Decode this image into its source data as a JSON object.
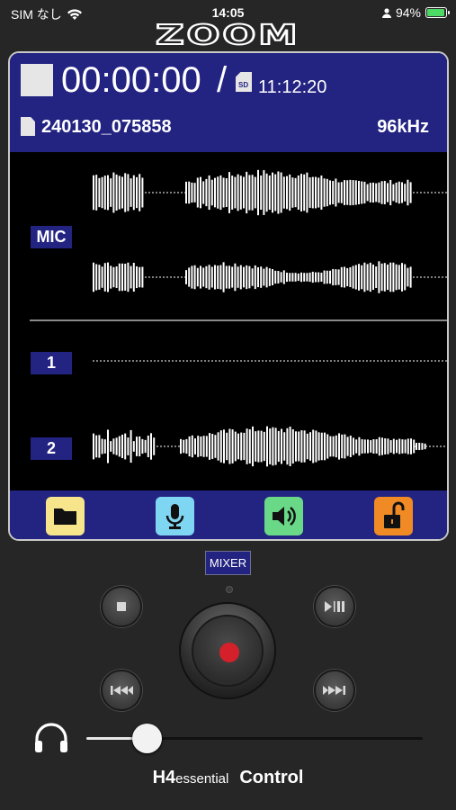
{
  "status_bar": {
    "carrier": "SIM なし",
    "time": "14:05",
    "battery_percent": "94%",
    "battery_level": 0.94
  },
  "logo": "ZOOM",
  "recorder": {
    "elapsed_time": "00:00:00",
    "separator": "/",
    "sd_label": "SD",
    "remaining_time": "11:12:20",
    "file_name": "240130_075858",
    "sample_rate": "96kHz"
  },
  "tracks": {
    "mic_label": "MIC",
    "track1_label": "1",
    "track2_label": "2"
  },
  "function_buttons": [
    {
      "name": "folder",
      "icon": "folder-icon",
      "color": "#f6e58a"
    },
    {
      "name": "mic",
      "icon": "microphone-icon",
      "color": "#7fd6f2"
    },
    {
      "name": "speaker",
      "icon": "speaker-icon",
      "color": "#6ad987"
    },
    {
      "name": "lock",
      "icon": "unlock-icon",
      "color": "#f08a24"
    }
  ],
  "controls": {
    "mixer_label": "MIXER",
    "volume_level": 0.18
  },
  "footer": {
    "model_main": "H4",
    "model_sub": "essential",
    "app_name": "Control"
  },
  "colors": {
    "screen_blue": "#232382",
    "record_red": "#d4202a",
    "background": "#262626"
  }
}
